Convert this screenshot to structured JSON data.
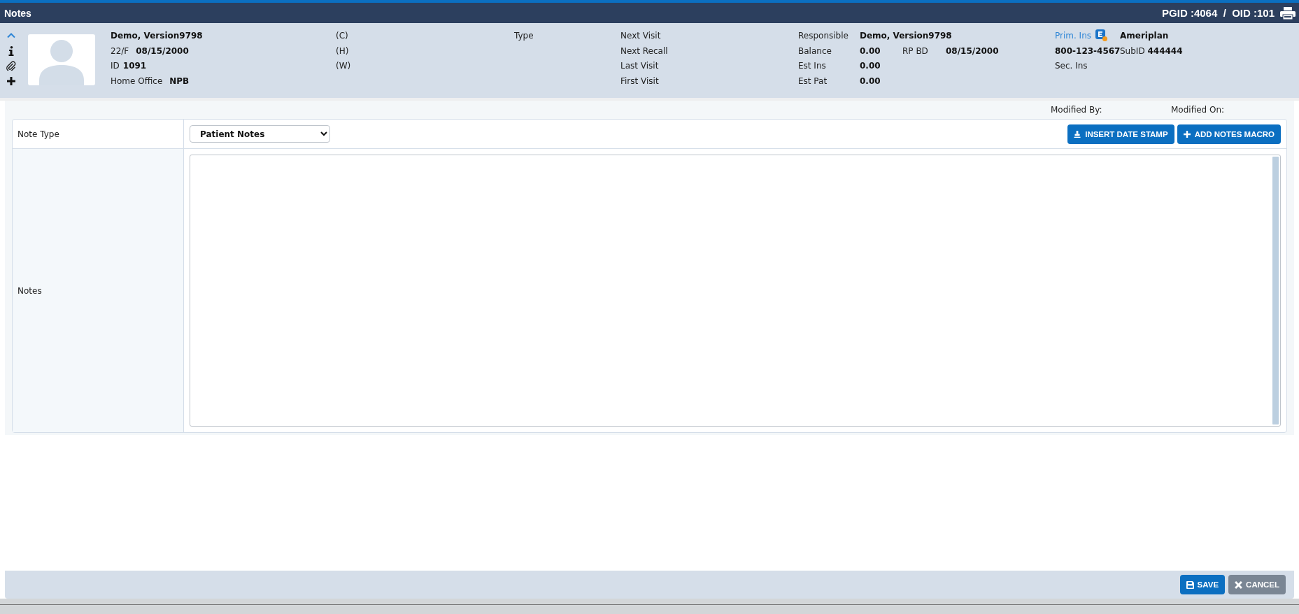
{
  "window": {
    "title": "Notes",
    "ids": "PGID :4064  /  OID :101"
  },
  "patient": {
    "name": "Demo, Version9798",
    "age_sex": "22/F",
    "dob": "08/15/2000",
    "id_label": "ID",
    "id": "1091",
    "office_label": "Home Office",
    "office": "NPB"
  },
  "phones": [
    "(C)",
    "(H)",
    "(W)"
  ],
  "type_label": "Type",
  "visits": [
    "Next Visit",
    "Next Recall",
    "Last Visit",
    "First Visit"
  ],
  "account": [
    {
      "label": "Responsible",
      "value": "Demo, Version9798"
    },
    {
      "label": "Balance",
      "value": "0.00",
      "extra_label": "RP BD",
      "extra_value": "08/15/2000"
    },
    {
      "label": "Est Ins",
      "value": "0.00"
    },
    {
      "label": "Est Pat",
      "value": "0.00"
    }
  ],
  "insurance": {
    "primary_label": "Prim. Ins",
    "primary_name": "Ameriplan",
    "phone": "800-123-4567",
    "subid_label": "SubID",
    "subid": "444444",
    "secondary_label": "Sec. Ins"
  },
  "modified": [
    "Modified By:",
    "Modified On:"
  ],
  "form": {
    "note_type": {
      "label": "Note Type",
      "value": "Patient Notes"
    },
    "buttons": [
      {
        "kind": "stamp",
        "label": "INSERT DATE STAMP"
      },
      {
        "kind": "add",
        "label": "ADD NOTES MACRO"
      }
    ],
    "notes": {
      "label": "Notes"
    }
  },
  "actions": [
    {
      "kind": "save",
      "label": "SAVE"
    },
    {
      "kind": "cancel",
      "label": "CANCEL"
    }
  ]
}
